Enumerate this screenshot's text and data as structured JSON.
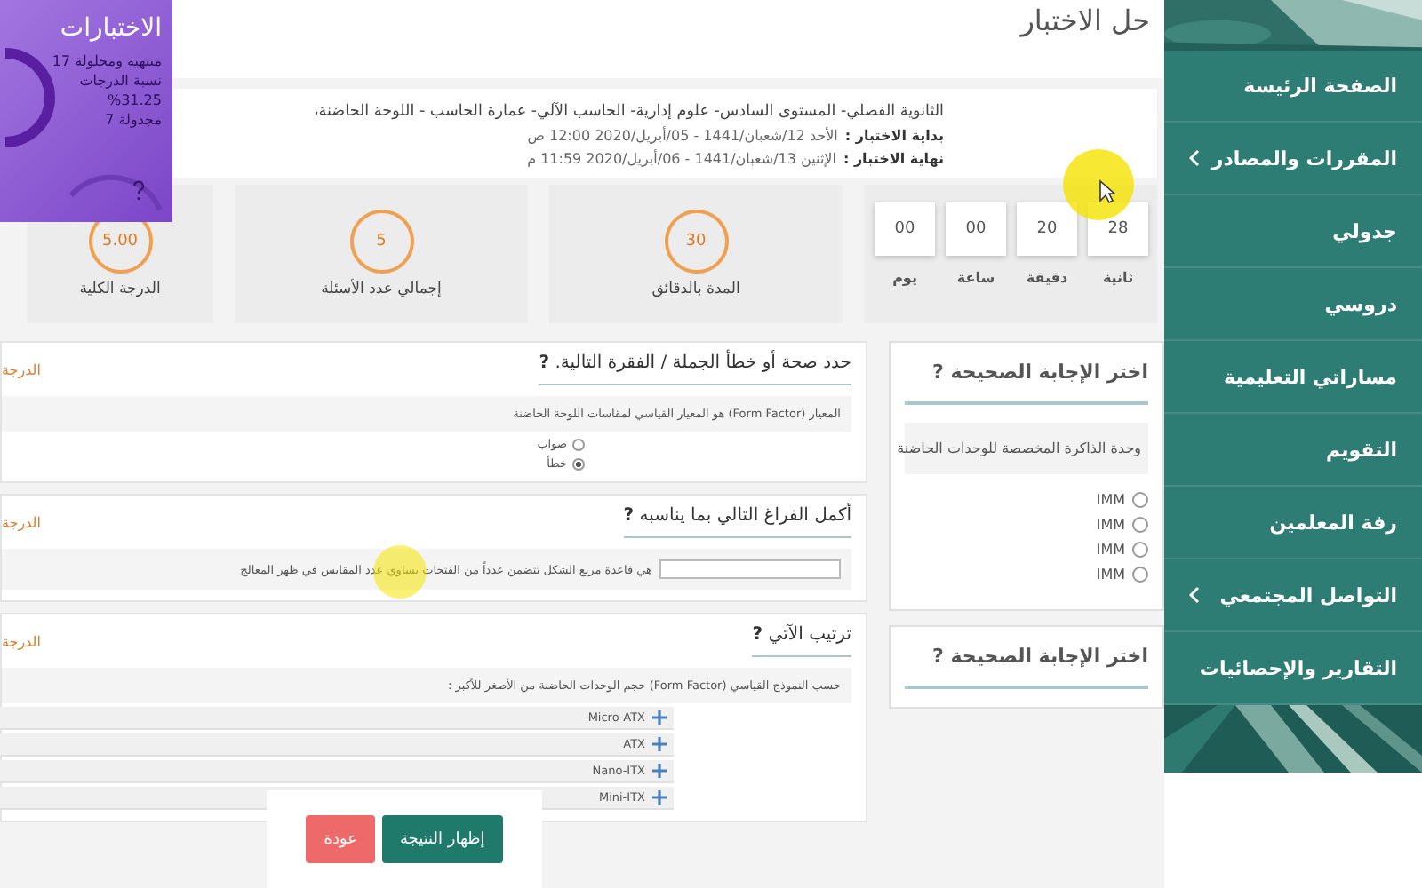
{
  "sidebar": {
    "items": [
      {
        "label": "الصفحة الرئيسة",
        "has_submenu": false
      },
      {
        "label": "المقررات والمصادر",
        "has_submenu": true
      },
      {
        "label": "جدولي",
        "has_submenu": false
      },
      {
        "label": "دروسي",
        "has_submenu": false
      },
      {
        "label": "مساراتي التعليمية",
        "has_submenu": false
      },
      {
        "label": "التقويم",
        "has_submenu": false
      },
      {
        "label": "رفة المعلمين",
        "has_submenu": false
      },
      {
        "label": "التواصل المجتمعي",
        "has_submenu": true
      },
      {
        "label": "التقارير والإحصائيات",
        "has_submenu": false
      }
    ]
  },
  "page_title": "حل الاختبار",
  "stats_widget": {
    "title": "الاختبارات",
    "completed": "منتهية ومحلولة 17",
    "score_label": "نسبة الدرجات",
    "score": "%31.25",
    "scheduled": "مجدولة 7"
  },
  "exam": {
    "title": "الثانوية الفصلي- المستوى السادس- علوم إدارية- الحاسب الآلي- عمارة الحاسب - اللوحة الحاضنة،",
    "start_label": "بداية الاختبار :",
    "start": "الأحد 12/شعبان/1441 - 05/أبريل/2020 12:00 ص",
    "end_label": "نهاية الاختبار :",
    "end": "الإثنين 13/شعبان/1441 - 06/أبريل/2020 11:59 م"
  },
  "countdown": [
    {
      "value": "28",
      "unit": "ثانية"
    },
    {
      "value": "20",
      "unit": "دقيقة"
    },
    {
      "value": "00",
      "unit": "ساعة"
    },
    {
      "value": "00",
      "unit": "يوم"
    }
  ],
  "stats": [
    {
      "value": "30",
      "label": "المدة بالدقائق"
    },
    {
      "value": "5",
      "label": "إجمالي عدد الأسئلة"
    },
    {
      "value": "5.00",
      "label": "الدرجة الكلية"
    }
  ],
  "side_questions": [
    {
      "title": "اختر الإجابة الصحيحة **?**",
      "prompt": "وحدة الذاكرة المخصصة للوحدات الحاضنة",
      "options": [
        {
          "label": "IMM",
          "selected": false
        },
        {
          "label": "IMM",
          "selected": false
        },
        {
          "label": "IMM",
          "selected": false
        },
        {
          "label": "IMM",
          "selected": false
        }
      ]
    },
    {
      "title": "اختر الإجابة الصحيحة **?**"
    }
  ],
  "questions": [
    {
      "kind": "true_false",
      "title": "حدد صحة أو خطأ الجملة / الفقرة التالية. **?**",
      "grade_label": "الدرجة",
      "prompt": "المعيار (Form Factor) هو المعيار القياسي لمقاسات اللوحة الحاضنة",
      "options": [
        {
          "label": "صواب",
          "selected": false
        },
        {
          "label": "خطأ",
          "selected": true
        }
      ]
    },
    {
      "kind": "fill_blank",
      "title": "أكمل الفراغ التالي بما يناسبه **?**",
      "grade_label": "الدرجة",
      "prompt": "هي قاعدة مربع الشكل تتضمن عدداً من الفتحات يساوي عدد المقابس في ظهر المعالج"
    },
    {
      "kind": "ordering",
      "title": "ترتيب الآتي **?**",
      "grade_label": "الدرجة",
      "prompt": "حسب النموذج القياسي (Form Factor) حجم الوحدات الحاضنة من الأصغر للأكبر :",
      "items": [
        "Micro-ATX",
        "ATX",
        "Nano-ITX",
        "Mini-ITX"
      ]
    }
  ],
  "buttons": [
    {
      "label": "إظهار النتيجة",
      "kind": "primary"
    },
    {
      "label": "عودة",
      "kind": "danger"
    }
  ]
}
